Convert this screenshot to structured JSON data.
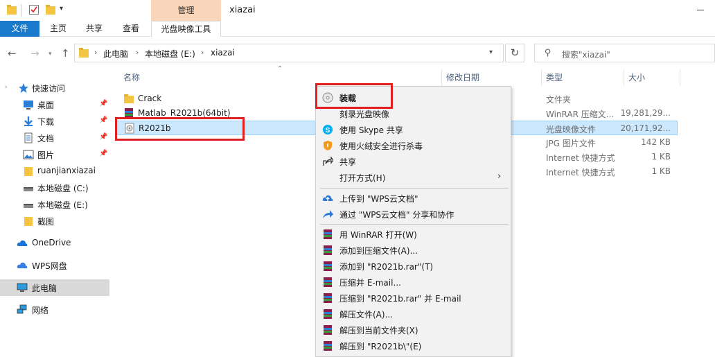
{
  "window": {
    "title": "xiazai",
    "context_tab": "管理"
  },
  "ribbon": {
    "tabs": [
      "文件",
      "主页",
      "共享",
      "查看",
      "光盘映像工具"
    ]
  },
  "address": {
    "crumbs": [
      "此电脑",
      "本地磁盘 (E:)",
      "xiazai"
    ],
    "search_placeholder": "搜索\"xiazai\""
  },
  "sidebar": {
    "items": [
      {
        "label": "快速访问",
        "icon": "star-icon"
      },
      {
        "label": "桌面",
        "icon": "desktop-icon"
      },
      {
        "label": "下载",
        "icon": "download-icon"
      },
      {
        "label": "文档",
        "icon": "document-icon"
      },
      {
        "label": "图片",
        "icon": "picture-icon"
      },
      {
        "label": "ruanjianxiazai",
        "icon": "folder-icon"
      },
      {
        "label": "本地磁盘 (C:)",
        "icon": "drive-icon"
      },
      {
        "label": "本地磁盘 (E:)",
        "icon": "drive-icon"
      },
      {
        "label": "截图",
        "icon": "folder-icon"
      },
      {
        "label": "OneDrive",
        "icon": "cloud-icon"
      },
      {
        "label": "WPS网盘",
        "icon": "cloud-icon"
      },
      {
        "label": "此电脑",
        "icon": "computer-icon"
      },
      {
        "label": "网络",
        "icon": "network-icon"
      }
    ]
  },
  "columns": {
    "name": "名称",
    "modified": "修改日期",
    "type": "类型",
    "size": "大小"
  },
  "files": [
    {
      "name": "Crack",
      "type": "文件夹",
      "size": ""
    },
    {
      "name": "Matlab_R2021b(64bit)",
      "type": "WinRAR 压缩文...",
      "size": "19,281,29..."
    },
    {
      "name": "R2021b",
      "type": "光盘映像文件",
      "size": "20,171,92..."
    },
    {
      "name": "",
      "type": "JPG 图片文件",
      "size": "142 KB"
    },
    {
      "name": "",
      "type": "Internet 快捷方式",
      "size": "1 KB"
    },
    {
      "name": "",
      "type": "Internet 快捷方式",
      "size": "1 KB"
    }
  ],
  "context_menu": {
    "items": [
      {
        "label": "装载",
        "icon": "disc-icon"
      },
      {
        "label": "刻录光盘映像",
        "icon": ""
      },
      {
        "label": "使用 Skype 共享",
        "icon": "skype-icon"
      },
      {
        "label": "使用火绒安全进行杀毒",
        "icon": "shield-icon"
      },
      {
        "label": "共享",
        "icon": "share-icon"
      },
      {
        "label": "打开方式(H)",
        "icon": ""
      },
      {
        "label": "上传到 \"WPS云文档\"",
        "icon": "upload-cloud-icon"
      },
      {
        "label": "通过 \"WPS云文档\" 分享和协作",
        "icon": "share-cloud-icon"
      },
      {
        "label": "用 WinRAR 打开(W)",
        "icon": "winrar-icon"
      },
      {
        "label": "添加到压缩文件(A)...",
        "icon": "winrar-icon"
      },
      {
        "label": "添加到 \"R2021b.rar\"(T)",
        "icon": "winrar-icon"
      },
      {
        "label": "压缩并 E-mail...",
        "icon": "winrar-icon"
      },
      {
        "label": "压缩到 \"R2021b.rar\" 并 E-mail",
        "icon": "winrar-icon"
      },
      {
        "label": "解压文件(A)...",
        "icon": "winrar-icon"
      },
      {
        "label": "解压到当前文件夹(X)",
        "icon": "winrar-icon"
      },
      {
        "label": "解压到 \"R2021b\\\"(E)",
        "icon": "winrar-icon"
      }
    ]
  },
  "colors": {
    "accent": "#1979ca",
    "selection": "#cce8ff",
    "highlight": "#e02020",
    "context_tab": "#f9d6ba"
  }
}
